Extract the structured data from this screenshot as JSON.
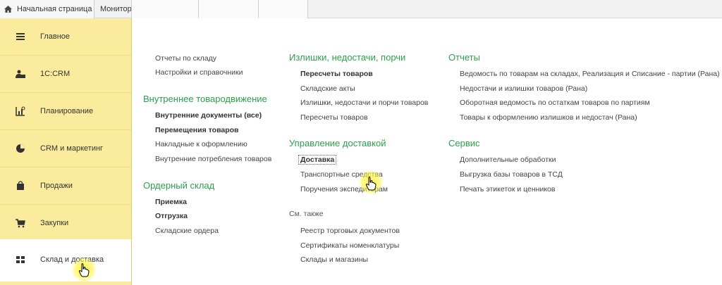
{
  "tabs": {
    "home": "Начальная страница",
    "monitor": "Монитор"
  },
  "sidebar": {
    "items": [
      {
        "label": "Главное",
        "icon": "menu-lines-icon"
      },
      {
        "label": "1С:CRM",
        "icon": "users-icon"
      },
      {
        "label": "Планирование",
        "icon": "planning-chart-icon"
      },
      {
        "label": "CRM и маркетинг",
        "icon": "pie-chart-icon"
      },
      {
        "label": "Продажи",
        "icon": "shopping-bag-icon"
      },
      {
        "label": "Закупки",
        "icon": "cart-icon"
      },
      {
        "label": "Склад и доставка",
        "icon": "warehouse-grid-icon",
        "active": true
      }
    ]
  },
  "menu": {
    "col1": {
      "top_links": [
        "Отчеты по складу",
        "Настройки и справочники"
      ],
      "internal": {
        "title": "Внутреннее товародвижение",
        "links": [
          "Внутренние документы (все)",
          "Перемещения товаров",
          "Накладные к оформлению",
          "Внутренние потребления товаров"
        ]
      },
      "order": {
        "title": "Ордерный склад",
        "links": [
          "Приемка",
          "Отгрузка",
          "Складские ордера"
        ]
      }
    },
    "col2": {
      "surplus": {
        "title": "Излишки, недостачи, порчи",
        "links": [
          "Пересчеты товаров",
          "Складские акты",
          "Излишки, недостачи и порчи товаров",
          "Пересчеты товаров"
        ]
      },
      "delivery": {
        "title": "Управление доставкой",
        "links": [
          "Доставка",
          "Транспортные средства",
          "Поручения экспедиторам"
        ]
      },
      "see_also": {
        "title": "См. также",
        "links": [
          "Реестр торговых документов",
          "Сертификаты номенклатуры",
          "Склады и магазины"
        ]
      }
    },
    "col3": {
      "reports": {
        "title": "Отчеты",
        "links": [
          "Ведомость по товарам на складах, Реализация и Списание - партии (Рана)",
          "Недостачи и излишки товаров (Рана)",
          "Оборотная ведомость по остаткам товаров по партиям",
          "Товары к оформлению излишков и недостач (Рана)"
        ]
      },
      "service": {
        "title": "Сервис",
        "links": [
          "Дополнительные обработки",
          "Выгрузка базы товаров в ТСД",
          "Печать этикеток и ценников"
        ]
      }
    }
  },
  "colors": {
    "sidebar_bg": "#fbec9d",
    "header_green": "#2aa14a",
    "highlight": "#fff53c"
  }
}
